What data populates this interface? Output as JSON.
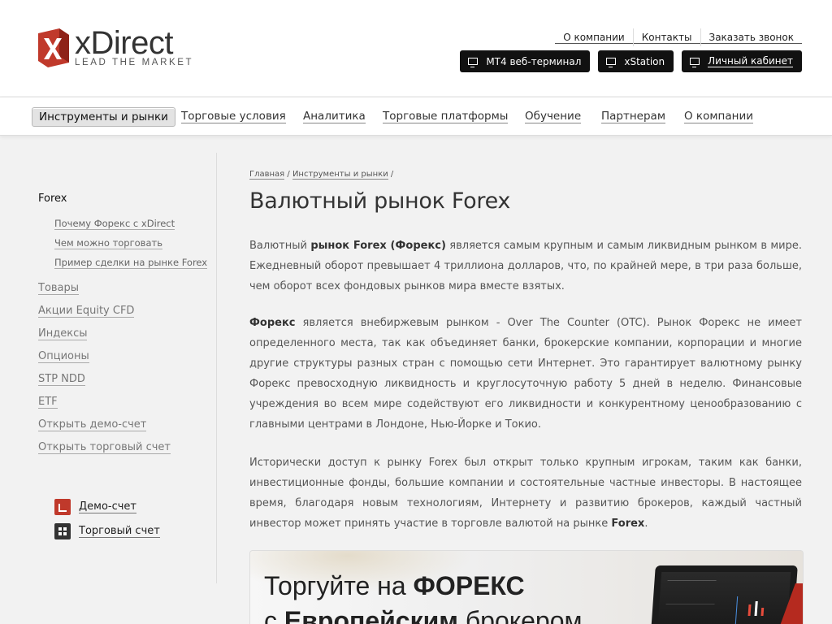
{
  "brand": {
    "name": "xDirect",
    "tagline": "LEAD THE MARKET",
    "accent_color": "#c0392b"
  },
  "top_links": [
    "О компании",
    "Контакты",
    "Заказать звонок"
  ],
  "top_buttons": [
    {
      "label": "MT4 веб-терминал",
      "icon": "monitor-icon"
    },
    {
      "label": "xStation",
      "icon": "monitor-icon"
    },
    {
      "label": "Личный кабинет",
      "icon": "id-card-icon"
    }
  ],
  "nav": [
    "Инструменты и рынки",
    "Торговые условия",
    "Аналитика",
    "Торговые платформы",
    "Обучение",
    "Партнерам",
    "О компании"
  ],
  "sidebar": {
    "current": "Forex",
    "sub_items": [
      "Почему Форекс с xDirect",
      "Чем можно торговать",
      "Пример сделки на рынке Forex"
    ],
    "items": [
      "Товары",
      "Акции Equity CFD",
      "Индексы",
      "Опционы",
      "STP NDD",
      "ETF",
      "Открыть демо-счет",
      "Открыть торговый счет"
    ],
    "accounts": [
      {
        "label": "Демо-счет",
        "icon": "chart-icon"
      },
      {
        "label": "Торговый счет",
        "icon": "grid-icon"
      }
    ]
  },
  "breadcrumb": [
    "Главная",
    "Инструменты и рынки"
  ],
  "breadcrumb_sep": "/",
  "title": "Валютный рынок Forex",
  "paragraphs": {
    "p1": {
      "a": "Валютный ",
      "b": "рынок Forex (Форекс)",
      "c": " является самым крупным и самым ликвидным рынком в мире. Ежедневный оборот превышает 4 триллиона долларов, что, по крайней мере, в три раза больше, чем оборот всех фондовых рынков мира вместе взятых."
    },
    "p2": {
      "b": "Форекс",
      "c": " является внебиржевым рынком - Over The Counter (OTC). Рынок Форекс не имеет определенного места, так как объединяет банки, брокерские компании, корпорации и многие другие структуры разных стран с помощью сети Интернет. Это гарантирует валютному рынку Форекс превосходную ликвидность и круглосуточную работу 5 дней в неделю. Финансовые учреждения во всем мире содействуют его ликвидности и конкурентному ценообразованию с главными центрами в Лондоне, Нью-Йорке и Токио."
    },
    "p3": {
      "a": "Исторически доступ к рынку Forex был открыт только крупным игрокам, таким как банки, инвестиционные фонды, большие компании и состоятельные частные инвесторы. В настоящее время, благодаря новым технологиям, Интернету и развитию брокеров, каждый частный инвестор может принять участие в торговле валютой на рынке ",
      "b": "Forex",
      "c": "."
    }
  },
  "banner": {
    "line1_a": "Торгуйте на ",
    "line1_b": "ФОРЕКС",
    "line2_a": "с ",
    "line2_b": "Европейским",
    "line2_c": " брокером"
  }
}
